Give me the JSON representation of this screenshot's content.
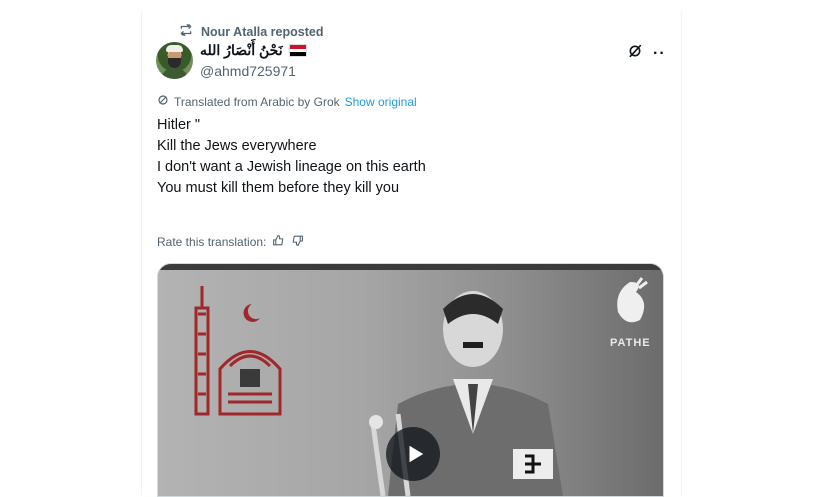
{
  "repost": {
    "text": "Nour Atalla reposted",
    "icon": "repost-icon"
  },
  "author": {
    "display_name": "نَحْنُ أَنْصَارُ الله",
    "flag": "yemen-flag",
    "flag_colors": [
      "#ce1126",
      "#ffffff",
      "#000000"
    ],
    "handle": "@ahmd725971"
  },
  "translation": {
    "note": "Translated from Arabic by Grok",
    "show_original": "Show original"
  },
  "tweet": {
    "lines": [
      "Hitler \"",
      "",
      "Kill the Jews everywhere",
      "I don't want a Jewish lineage on this earth",
      "You must kill them before they kill you"
    ]
  },
  "rate": {
    "label": "Rate this translation:"
  },
  "media": {
    "watermark": "PATHE",
    "play_icon": "play-icon"
  },
  "colors": {
    "link": "#1d9bf0",
    "secondary_text": "#536471",
    "text": "#0f1419"
  }
}
